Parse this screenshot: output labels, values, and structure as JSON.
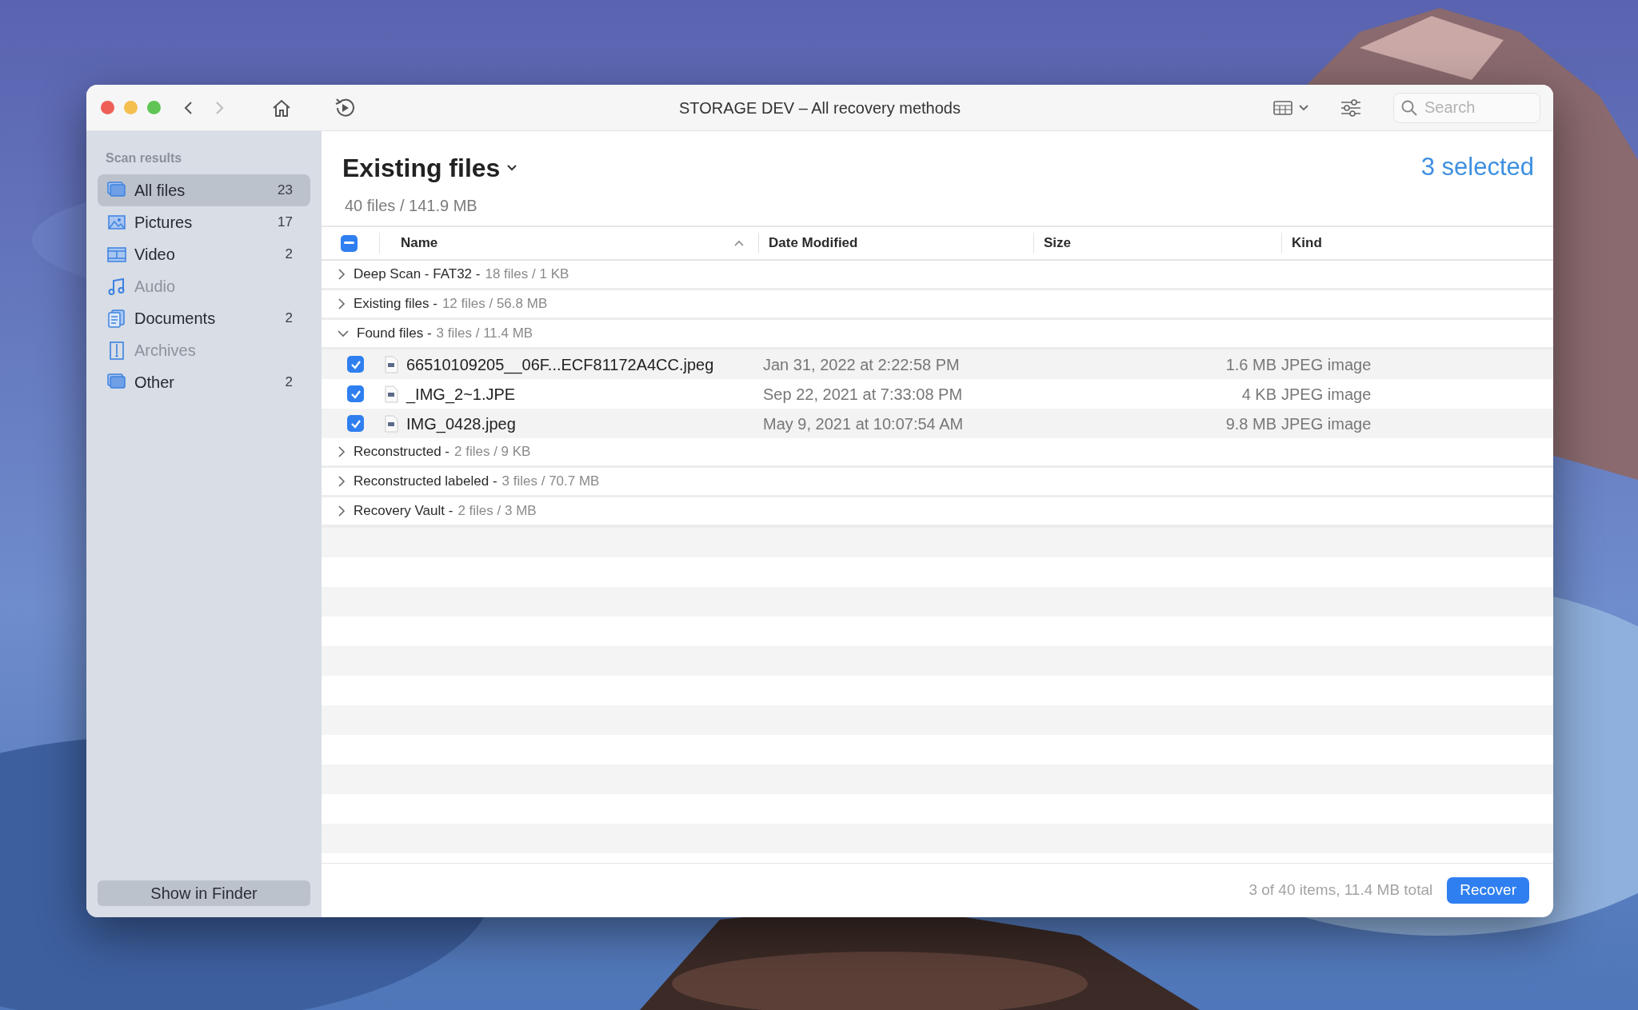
{
  "window": {
    "title": "STORAGE DEV – All recovery methods"
  },
  "toolbar": {
    "search": {
      "placeholder": "Search"
    },
    "forward_disabled": true
  },
  "sidebar": {
    "heading": "Scan results",
    "items": [
      {
        "label": "All files",
        "count": "23",
        "selected": true,
        "disabled": false
      },
      {
        "label": "Pictures",
        "count": "17",
        "selected": false,
        "disabled": false
      },
      {
        "label": "Video",
        "count": "2",
        "selected": false,
        "disabled": false
      },
      {
        "label": "Audio",
        "selected": false,
        "disabled": true
      },
      {
        "label": "Documents",
        "count": "2",
        "selected": false,
        "disabled": false
      },
      {
        "label": "Archives",
        "selected": false,
        "disabled": true
      },
      {
        "label": "Other",
        "count": "2",
        "selected": false,
        "disabled": false
      }
    ],
    "show_in_finder": "Show in Finder"
  },
  "header": {
    "title": "Existing files",
    "subtitle": "40 files / 141.9 MB",
    "selected_count": "3 selected"
  },
  "table": {
    "select_all_indeterminate": true,
    "columns": [
      {
        "label": "Name",
        "sorted": true
      },
      {
        "label": "Date Modified",
        "sorted": false
      },
      {
        "label": "Size",
        "sorted": false
      },
      {
        "label": "Kind",
        "sorted": false
      }
    ],
    "groups": [
      {
        "name": "Deep Scan - FAT32 -",
        "summary": "18 files / 1 KB",
        "expanded": false
      },
      {
        "name": "Existing files -",
        "summary": "12 files / 56.8 MB",
        "expanded": false
      },
      {
        "name": "Found files -",
        "summary": "3 files / 11.4 MB",
        "expanded": true,
        "children": [
          {
            "name": "66510109205__06F...ECF81172A4CC.jpeg",
            "date": "Jan 31, 2022 at 2:22:58 PM",
            "size": "1.6 MB",
            "file_type": "JPEG image",
            "checked": true
          },
          {
            "name": "_IMG_2~1.JPE",
            "date": "Sep 22, 2021 at 7:33:08 PM",
            "size": "4 KB",
            "file_type": "JPEG image",
            "checked": true
          },
          {
            "name": "IMG_0428.jpeg",
            "date": "May 9, 2021 at 10:07:54 AM",
            "size": "9.8 MB",
            "file_type": "JPEG image",
            "checked": true
          }
        ]
      },
      {
        "name": "Reconstructed -",
        "summary": "2 files / 9 KB",
        "expanded": false
      },
      {
        "name": "Reconstructed labeled -",
        "summary": "3 files / 70.7 MB",
        "expanded": false
      },
      {
        "name": "Recovery Vault -",
        "summary": "2 files / 3 MB",
        "expanded": false
      }
    ]
  },
  "footer": {
    "status": "3 of 40 items, 11.4 MB total",
    "recover": "Recover"
  }
}
